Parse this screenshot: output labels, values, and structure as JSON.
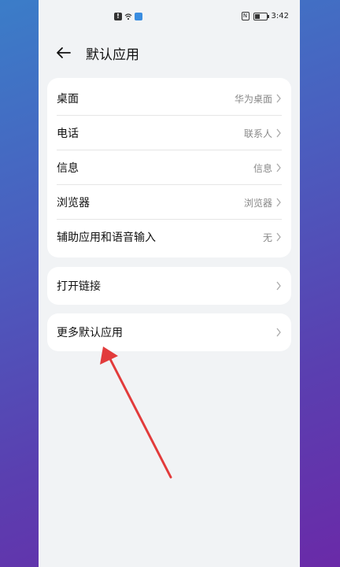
{
  "status_bar": {
    "time": "3:42"
  },
  "header": {
    "title": "默认应用"
  },
  "groups": [
    {
      "items": [
        {
          "label": "桌面",
          "value": "华为桌面"
        },
        {
          "label": "电话",
          "value": "联系人"
        },
        {
          "label": "信息",
          "value": "信息"
        },
        {
          "label": "浏览器",
          "value": "浏览器"
        },
        {
          "label": "辅助应用和语音输入",
          "value": "无"
        }
      ]
    },
    {
      "items": [
        {
          "label": "打开链接",
          "value": ""
        }
      ]
    },
    {
      "items": [
        {
          "label": "更多默认应用",
          "value": ""
        }
      ]
    }
  ],
  "icons": {
    "back": "arrow-left-icon",
    "chevron": "chevron-right-icon",
    "annotation": "red-arrow"
  },
  "colors": {
    "annotation_arrow": "#e23b3b",
    "card_bg": "#ffffff",
    "page_bg": "#f1f3f5"
  }
}
